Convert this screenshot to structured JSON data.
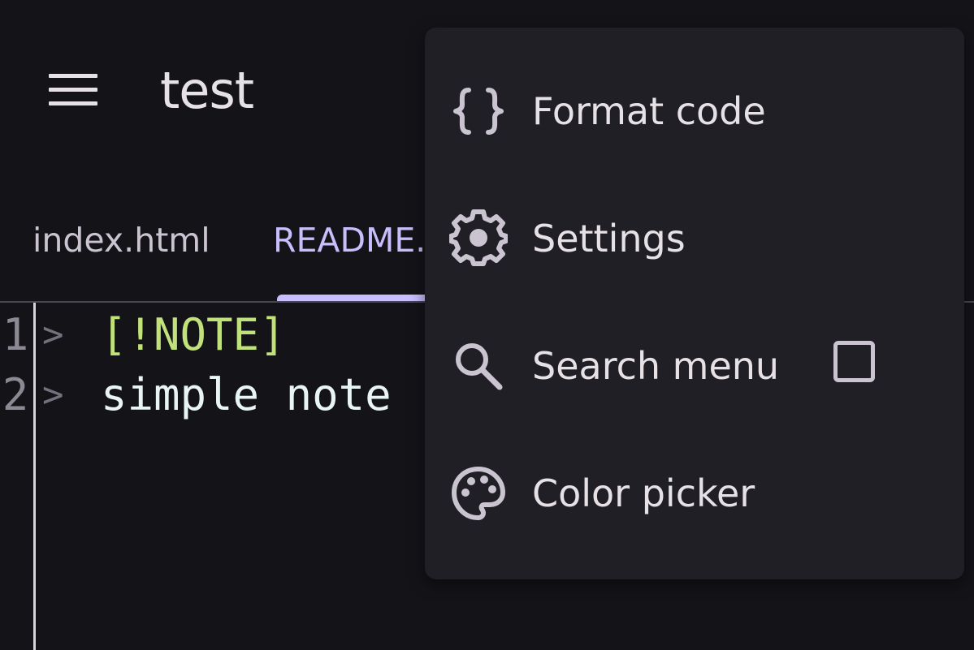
{
  "header": {
    "title": "test",
    "menu_icon": "hamburger-menu-icon"
  },
  "tabs": [
    {
      "label": "index.html",
      "active": false
    },
    {
      "label": "README.",
      "active": true
    }
  ],
  "editor": {
    "lines": [
      {
        "number": "1",
        "quote": ">",
        "text": "[!NOTE]"
      },
      {
        "number": "2",
        "quote": ">",
        "text": "simple note"
      }
    ]
  },
  "menu": {
    "items": [
      {
        "label": "Format code",
        "icon": "curly-braces-icon"
      },
      {
        "label": "Settings",
        "icon": "gear-icon"
      },
      {
        "label": "Search menu",
        "icon": "search-icon",
        "checkbox_checked": false
      },
      {
        "label": "Color picker",
        "icon": "palette-icon"
      }
    ]
  },
  "colors": {
    "background": "#141318",
    "menu_background": "#211f26",
    "accent": "#c9bdfc",
    "note_tag": "#c1e27a"
  }
}
